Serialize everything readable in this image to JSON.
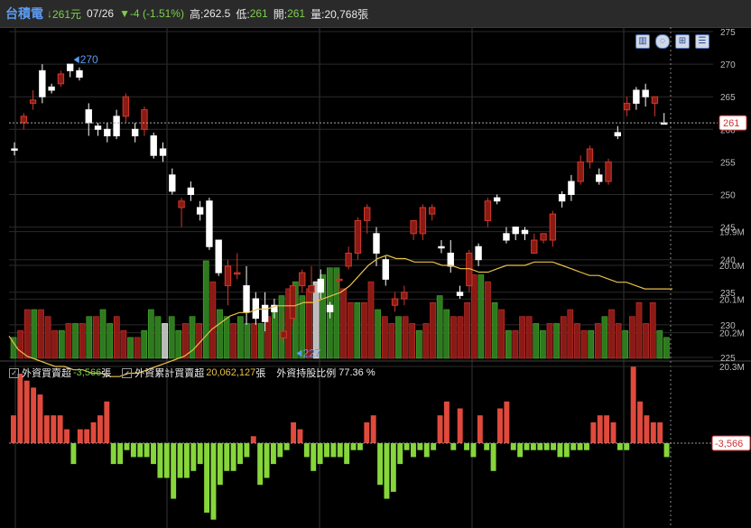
{
  "header": {
    "name": "台積電",
    "price": "261元",
    "date": "07/26",
    "change": "▼-4 (-1.51%)",
    "high_label": "高:",
    "high": "262.5",
    "low_label": "低:",
    "low": "261",
    "open_label": "開:",
    "open": "261",
    "volume_label": "量:",
    "volume": "20,768張"
  },
  "toolbar": {
    "icons": [
      "save-icon",
      "settings-icon",
      "zoom-icon",
      "adjust-icon"
    ]
  },
  "indicators": {
    "net_buy_label": "外資買賣超",
    "net_buy_value": "-3,566",
    "net_buy_unit": "張",
    "cum_label": "外資累計買賣超",
    "cum_value": "20,062,127",
    "cum_unit": "張",
    "holding_label": "外資持股比例",
    "holding_value": "77.36 %"
  },
  "chart_data": [
    {
      "type": "candlestick",
      "title": "",
      "y_ticks": [
        225,
        230,
        235,
        240,
        245,
        250,
        255,
        260,
        265,
        270,
        275
      ],
      "ylim": [
        225,
        275
      ],
      "current_price_label": "261",
      "current_price": 261,
      "max_marker": {
        "label": "270",
        "value": 270,
        "index": 6
      },
      "min_marker": {
        "label": "227",
        "value": 227,
        "index": 30
      },
      "grid": true,
      "candles": [
        {
          "o": 257,
          "c": 257,
          "h": 258,
          "l": 256,
          "up": true
        },
        {
          "o": 261,
          "c": 262,
          "h": 262.5,
          "l": 260,
          "up": false
        },
        {
          "o": 264,
          "c": 264.5,
          "h": 266,
          "l": 263,
          "up": false
        },
        {
          "o": 265,
          "c": 269,
          "h": 270,
          "l": 264,
          "up": true
        },
        {
          "o": 266,
          "c": 266.5,
          "h": 267,
          "l": 265.5,
          "up": true
        },
        {
          "o": 267,
          "c": 268.5,
          "h": 269,
          "l": 266.5,
          "up": false
        },
        {
          "o": 269,
          "c": 270,
          "h": 270,
          "l": 268,
          "up": true
        },
        {
          "o": 268,
          "c": 269,
          "h": 269.5,
          "l": 267.5,
          "up": true
        },
        {
          "o": 263,
          "c": 261,
          "h": 264,
          "l": 259,
          "up": true
        },
        {
          "o": 260,
          "c": 260.5,
          "h": 261,
          "l": 259,
          "up": true
        },
        {
          "o": 260,
          "c": 259,
          "h": 261,
          "l": 258,
          "up": true
        },
        {
          "o": 262,
          "c": 259,
          "h": 263,
          "l": 258.5,
          "up": true
        },
        {
          "o": 262,
          "c": 265,
          "h": 265.5,
          "l": 261,
          "up": false
        },
        {
          "o": 260,
          "c": 259,
          "h": 261,
          "l": 258,
          "up": true
        },
        {
          "o": 260,
          "c": 263,
          "h": 263.5,
          "l": 259,
          "up": false
        },
        {
          "o": 259,
          "c": 256,
          "h": 259.5,
          "l": 255.5,
          "up": true
        },
        {
          "o": 257,
          "c": 256,
          "h": 258,
          "l": 255,
          "up": true
        },
        {
          "o": 253,
          "c": 250.5,
          "h": 254,
          "l": 250,
          "up": true
        },
        {
          "o": 248,
          "c": 249,
          "h": 249.5,
          "l": 245,
          "up": false
        },
        {
          "o": 251,
          "c": 250,
          "h": 252,
          "l": 249,
          "up": true
        },
        {
          "o": 248,
          "c": 247,
          "h": 249,
          "l": 246,
          "up": true
        },
        {
          "o": 249,
          "c": 242,
          "h": 249.5,
          "l": 241.5,
          "up": true
        },
        {
          "o": 243,
          "c": 238,
          "h": 243,
          "l": 237.5,
          "up": true
        },
        {
          "o": 236,
          "c": 239,
          "h": 240,
          "l": 233,
          "up": false
        },
        {
          "o": 238,
          "c": 238,
          "h": 241,
          "l": 237,
          "up": false
        },
        {
          "o": 236,
          "c": 232,
          "h": 239,
          "l": 230,
          "up": true
        },
        {
          "o": 231,
          "c": 234,
          "h": 235,
          "l": 230,
          "up": true
        },
        {
          "o": 233,
          "c": 230.5,
          "h": 235,
          "l": 229,
          "up": true
        },
        {
          "o": 233,
          "c": 232,
          "h": 234,
          "l": 231,
          "up": true
        },
        {
          "o": 228,
          "c": 229,
          "h": 232,
          "l": 227,
          "up": false
        },
        {
          "o": 231,
          "c": 236,
          "h": 236.5,
          "l": 230,
          "up": false
        },
        {
          "o": 236,
          "c": 238,
          "h": 238.5,
          "l": 235,
          "up": false
        },
        {
          "o": 235,
          "c": 236,
          "h": 239,
          "l": 235,
          "up": false
        },
        {
          "o": 237,
          "c": 235,
          "h": 238.5,
          "l": 234,
          "up": true
        },
        {
          "o": 233,
          "c": 232,
          "h": 233.5,
          "l": 231,
          "up": true
        },
        {
          "o": 237,
          "c": 237,
          "h": 238,
          "l": 235,
          "up": false
        },
        {
          "o": 239,
          "c": 241,
          "h": 242,
          "l": 238.5,
          "up": false
        },
        {
          "o": 241,
          "c": 246,
          "h": 246.5,
          "l": 240,
          "up": false
        },
        {
          "o": 246,
          "c": 248,
          "h": 248.5,
          "l": 244,
          "up": false
        },
        {
          "o": 244,
          "c": 241,
          "h": 245,
          "l": 239,
          "up": true
        },
        {
          "o": 240,
          "c": 237,
          "h": 240.5,
          "l": 236,
          "up": true
        },
        {
          "o": 233,
          "c": 234,
          "h": 235,
          "l": 232,
          "up": false
        },
        {
          "o": 234,
          "c": 235,
          "h": 236,
          "l": 233,
          "up": false
        },
        {
          "o": 244,
          "c": 246,
          "h": 246,
          "l": 243,
          "up": false
        },
        {
          "o": 244,
          "c": 248,
          "h": 248.5,
          "l": 243,
          "up": false
        },
        {
          "o": 247,
          "c": 248,
          "h": 248.5,
          "l": 246,
          "up": false
        },
        {
          "o": 242,
          "c": 242,
          "h": 243,
          "l": 241,
          "up": true
        },
        {
          "o": 241,
          "c": 239,
          "h": 243,
          "l": 238,
          "up": true
        },
        {
          "o": 235,
          "c": 234.5,
          "h": 236,
          "l": 234,
          "up": true
        },
        {
          "o": 236,
          "c": 241,
          "h": 241.5,
          "l": 235,
          "up": false
        },
        {
          "o": 242,
          "c": 240,
          "h": 242.5,
          "l": 239,
          "up": true
        },
        {
          "o": 246,
          "c": 249,
          "h": 249.5,
          "l": 245,
          "up": false
        },
        {
          "o": 249.5,
          "c": 249,
          "h": 250,
          "l": 248.5,
          "up": true
        },
        {
          "o": 244,
          "c": 243,
          "h": 245,
          "l": 242.5,
          "up": true
        },
        {
          "o": 245,
          "c": 244,
          "h": 245,
          "l": 243,
          "up": true
        },
        {
          "o": 244.5,
          "c": 244,
          "h": 245,
          "l": 243,
          "up": true
        },
        {
          "o": 241,
          "c": 243,
          "h": 244,
          "l": 241,
          "up": false
        },
        {
          "o": 243,
          "c": 244,
          "h": 244,
          "l": 242.5,
          "up": false
        },
        {
          "o": 243,
          "c": 247,
          "h": 247.5,
          "l": 242,
          "up": false
        },
        {
          "o": 249,
          "c": 250,
          "h": 250.5,
          "l": 248,
          "up": true
        },
        {
          "o": 250,
          "c": 252,
          "h": 253,
          "l": 249,
          "up": true
        },
        {
          "o": 252,
          "c": 255,
          "h": 256,
          "l": 251.5,
          "up": false
        },
        {
          "o": 255,
          "c": 257,
          "h": 257.5,
          "l": 254,
          "up": false
        },
        {
          "o": 253,
          "c": 252,
          "h": 254,
          "l": 251.5,
          "up": true
        },
        {
          "o": 252,
          "c": 255,
          "h": 255.5,
          "l": 251.5,
          "up": false
        },
        {
          "o": 259,
          "c": 259.5,
          "h": 260.5,
          "l": 258.5,
          "up": true
        },
        {
          "o": 263,
          "c": 264,
          "h": 265,
          "l": 262,
          "up": false
        },
        {
          "o": 264,
          "c": 266,
          "h": 266.5,
          "l": 263,
          "up": true
        },
        {
          "o": 265,
          "c": 266,
          "h": 267,
          "l": 263.5,
          "up": true
        },
        {
          "o": 265,
          "c": 264,
          "h": 265,
          "l": 262,
          "up": false
        },
        {
          "o": 261,
          "c": 261,
          "h": 262.5,
          "l": 261,
          "up": true
        }
      ]
    },
    {
      "type": "bar",
      "title": "volume",
      "values": [
        3,
        4,
        7,
        7,
        7,
        6,
        4,
        4,
        5,
        5,
        5,
        6,
        6,
        7,
        5,
        6,
        4,
        3,
        3,
        4,
        7,
        6,
        5,
        6,
        4,
        5,
        6,
        5,
        14,
        11,
        7,
        6,
        5,
        6,
        5,
        5,
        5,
        6,
        7,
        9,
        10,
        11,
        9,
        10,
        11,
        12,
        13,
        13,
        10,
        8,
        8,
        8,
        11,
        7,
        6,
        5,
        6,
        6,
        5,
        4,
        5,
        8,
        9,
        7,
        6,
        6,
        8,
        12,
        12,
        11,
        8,
        7,
        4,
        4,
        6,
        6,
        5,
        4,
        5,
        5,
        6,
        7,
        5,
        4,
        4,
        5,
        6,
        7,
        5,
        4,
        6,
        8,
        5,
        8,
        4,
        3
      ],
      "colors": "mixed"
    },
    {
      "type": "bar+line",
      "title": "外資買賣超",
      "y_ticks_labels": [
        "20.3M",
        "20.2M",
        "20.1M",
        "20.0M",
        "19.9M"
      ],
      "y_ticks": [
        20.3,
        20.2,
        20.1,
        20.0,
        19.9
      ],
      "ylim": [
        19.9,
        20.36
      ],
      "current_label": "-3,566",
      "bars": [
        4,
        10,
        9,
        8,
        7,
        4,
        4,
        4,
        2,
        -3,
        2,
        2,
        3,
        4,
        6,
        -3,
        -3,
        -1,
        -2,
        -2,
        -2,
        -3,
        -5,
        -5,
        -8,
        -5,
        -5,
        -4,
        -3,
        -10,
        -11,
        -6,
        -4,
        -4,
        -3,
        -2,
        1,
        -6,
        -5,
        -3,
        -2,
        -1,
        3,
        2,
        -2,
        -4,
        -3,
        -2,
        -2,
        -2,
        -3,
        -1,
        -1,
        3,
        4,
        -6,
        -8,
        -7,
        -3,
        -1,
        -2,
        -1,
        -2,
        -1,
        4,
        6,
        -1,
        5,
        -1,
        -2,
        4,
        -1,
        -4,
        5,
        6,
        -1,
        -2,
        -1,
        -1,
        -1,
        -1,
        -1,
        -2,
        -2,
        -1,
        -1,
        -1,
        3,
        4,
        4,
        3,
        -1,
        -1,
        11,
        6,
        4,
        3,
        3,
        -2
      ],
      "line": [
        20.21,
        20.25,
        20.27,
        20.28,
        20.29,
        20.3,
        20.3,
        20.31,
        20.31,
        20.32,
        20.32,
        20.33,
        20.33,
        20.32,
        20.32,
        20.31,
        20.3,
        20.29,
        20.28,
        20.27,
        20.25,
        20.22,
        20.19,
        20.17,
        20.15,
        20.14,
        20.14,
        20.13,
        20.13,
        20.12,
        20.12,
        20.12,
        20.11,
        20.11,
        20.1,
        20.09,
        20.08,
        20.06,
        20.03,
        20.0,
        19.98,
        19.97,
        19.98,
        19.98,
        19.99,
        19.99,
        19.99,
        20.0,
        20.0,
        20.01,
        20.01,
        20.02,
        20.02,
        20.01,
        20.0,
        20.0,
        20.0,
        19.99,
        19.99,
        19.99,
        20.0,
        20.01,
        20.02,
        20.03,
        20.03,
        20.04,
        20.05,
        20.05,
        20.06,
        20.07,
        20.07,
        20.07,
        20.07
      ]
    }
  ]
}
